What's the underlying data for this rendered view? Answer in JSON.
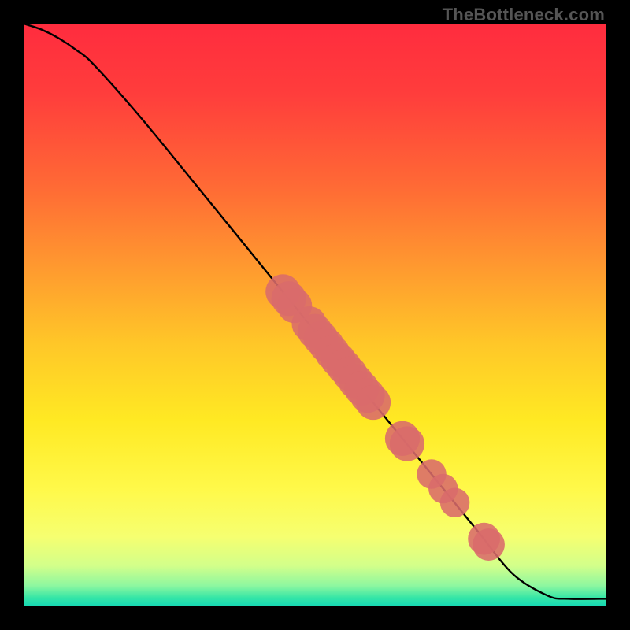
{
  "watermark": "TheBottleneck.com",
  "chart_data": {
    "type": "line",
    "title": "",
    "xlabel": "",
    "ylabel": "",
    "xlim": [
      0,
      100
    ],
    "ylim": [
      0,
      100
    ],
    "curve": {
      "name": "bottleneck-curve",
      "x": [
        0,
        3,
        6,
        9,
        12,
        20,
        30,
        40,
        50,
        58,
        65,
        72,
        78,
        84,
        90,
        93.5,
        100
      ],
      "y": [
        100,
        99,
        97.5,
        95.5,
        93,
        84,
        71.8,
        59.5,
        47.2,
        37.4,
        28.8,
        20.2,
        12.8,
        5.5,
        1.8,
        1.3,
        1.3
      ]
    },
    "markers": {
      "name": "highlighted-points",
      "color": "#d96b6b",
      "points": [
        {
          "x": 44.5,
          "y": 54.0,
          "r": 2.6
        },
        {
          "x": 45.5,
          "y": 52.8,
          "r": 2.6
        },
        {
          "x": 46.5,
          "y": 51.6,
          "r": 2.6
        },
        {
          "x": 49.0,
          "y": 48.5,
          "r": 2.6
        },
        {
          "x": 50.0,
          "y": 47.2,
          "r": 2.6
        },
        {
          "x": 51.0,
          "y": 46.0,
          "r": 2.6
        },
        {
          "x": 52.0,
          "y": 44.8,
          "r": 2.6
        },
        {
          "x": 53.0,
          "y": 43.5,
          "r": 2.6
        },
        {
          "x": 54.0,
          "y": 42.3,
          "r": 2.6
        },
        {
          "x": 55.0,
          "y": 41.1,
          "r": 2.6
        },
        {
          "x": 56.0,
          "y": 39.9,
          "r": 2.6
        },
        {
          "x": 57.0,
          "y": 38.6,
          "r": 2.6
        },
        {
          "x": 58.0,
          "y": 37.4,
          "r": 2.6
        },
        {
          "x": 59.0,
          "y": 36.2,
          "r": 2.6
        },
        {
          "x": 60.0,
          "y": 35.0,
          "r": 2.6
        },
        {
          "x": 65.0,
          "y": 28.8,
          "r": 2.6
        },
        {
          "x": 65.8,
          "y": 27.9,
          "r": 2.6
        },
        {
          "x": 70.0,
          "y": 22.7,
          "r": 2.2
        },
        {
          "x": 72.0,
          "y": 20.2,
          "r": 2.2
        },
        {
          "x": 74.0,
          "y": 17.8,
          "r": 2.2
        },
        {
          "x": 79.0,
          "y": 11.6,
          "r": 2.4
        },
        {
          "x": 79.8,
          "y": 10.6,
          "r": 2.4
        }
      ]
    },
    "background_gradient": {
      "direction": "vertical",
      "stops": [
        {
          "offset": 0.0,
          "color": "#ff2c3e"
        },
        {
          "offset": 0.12,
          "color": "#ff3d3c"
        },
        {
          "offset": 0.28,
          "color": "#ff6a35"
        },
        {
          "offset": 0.42,
          "color": "#ff9a2f"
        },
        {
          "offset": 0.55,
          "color": "#ffc728"
        },
        {
          "offset": 0.68,
          "color": "#ffe923"
        },
        {
          "offset": 0.8,
          "color": "#fff94a"
        },
        {
          "offset": 0.88,
          "color": "#f6ff70"
        },
        {
          "offset": 0.93,
          "color": "#d3ff8a"
        },
        {
          "offset": 0.965,
          "color": "#8cf7a0"
        },
        {
          "offset": 0.985,
          "color": "#36e6a6"
        },
        {
          "offset": 1.0,
          "color": "#14d8b4"
        }
      ]
    }
  }
}
